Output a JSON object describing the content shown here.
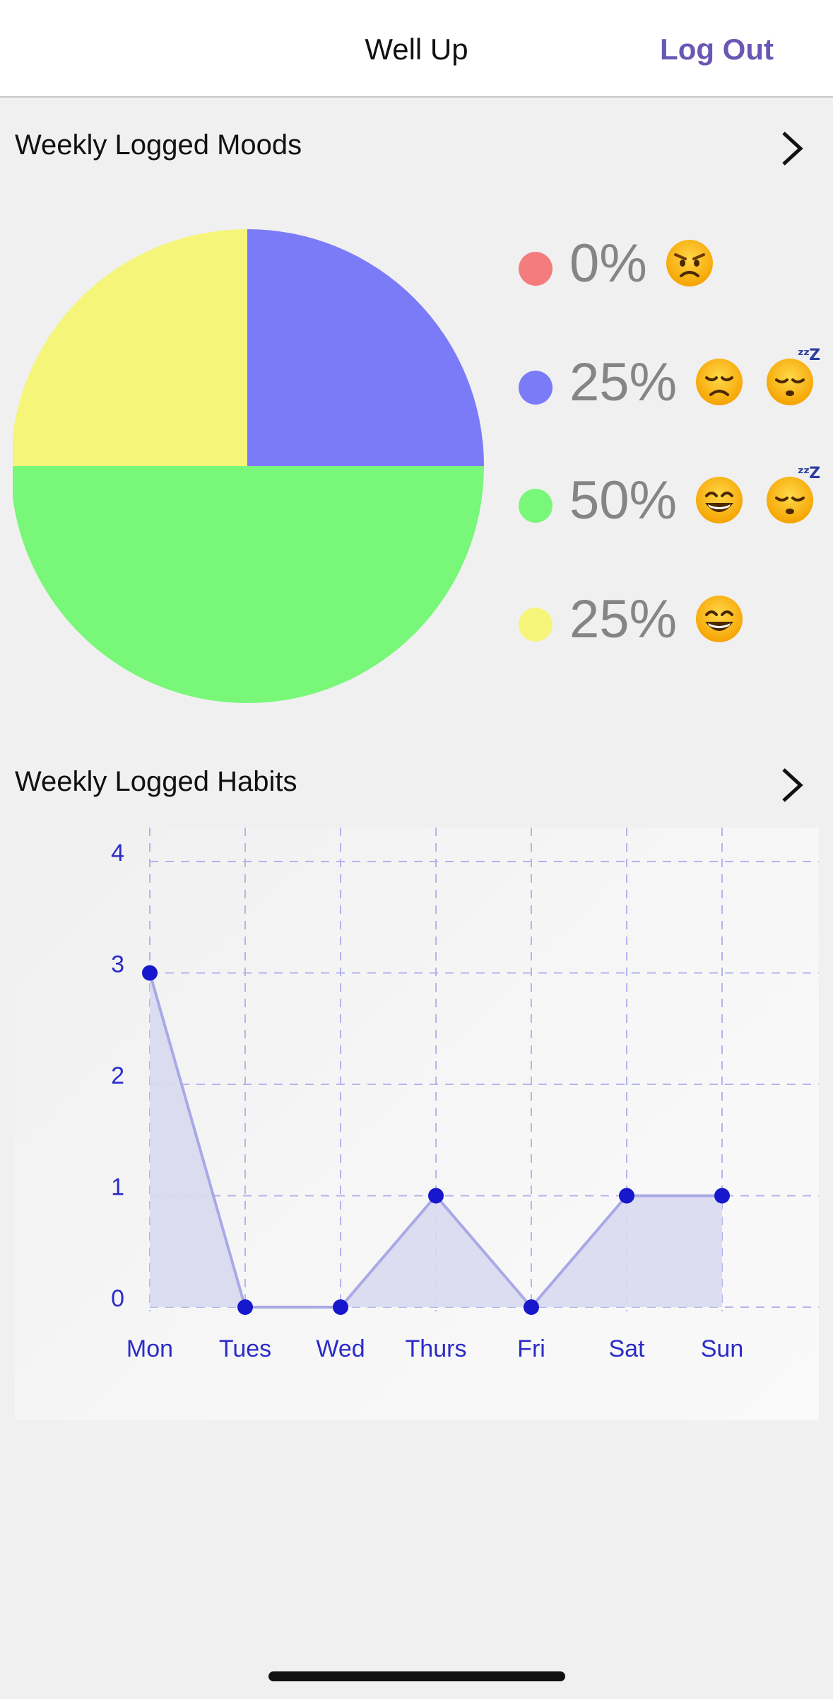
{
  "nav": {
    "title": "Well Up",
    "logout_label": "Log Out"
  },
  "moods": {
    "title": "Weekly Logged Moods",
    "legend": [
      {
        "percent": "0%",
        "color": "#f57c7c",
        "emojis": [
          "angry-face-icon"
        ]
      },
      {
        "percent": "25%",
        "color": "#7b7bf8",
        "emojis": [
          "disappointed-face-icon",
          "sleeping-face-icon"
        ]
      },
      {
        "percent": "50%",
        "color": "#78f778",
        "emojis": [
          "grinning-face-icon",
          "sleeping-face-icon"
        ]
      },
      {
        "percent": "25%",
        "color": "#f5f57a",
        "emojis": [
          "grinning-face-icon"
        ]
      }
    ]
  },
  "habits": {
    "title": "Weekly Logged Habits"
  },
  "chart_data": [
    {
      "type": "pie",
      "slices": [
        {
          "value": 0,
          "color": "#f57c7c"
        },
        {
          "value": 25,
          "color": "#7b7bf8"
        },
        {
          "value": 50,
          "color": "#78f778"
        },
        {
          "value": 25,
          "color": "#f5f57a"
        }
      ],
      "start": "top",
      "direction": "clockwise"
    },
    {
      "type": "area",
      "categories": [
        "Mon",
        "Tues",
        "Wed",
        "Thurs",
        "Fri",
        "Sat",
        "Sun"
      ],
      "values": [
        3,
        0,
        0,
        1,
        0,
        1,
        1
      ],
      "ylim": [
        0,
        4
      ],
      "yticks": [
        "0",
        "1",
        "2",
        "3",
        "4"
      ],
      "grid": true,
      "colors": {
        "line": "#a9a9e6",
        "fill": "#d9d9f0",
        "point": "#1717cc",
        "grid": "#b4b4ec",
        "label": "#2b2bc8"
      }
    }
  ]
}
